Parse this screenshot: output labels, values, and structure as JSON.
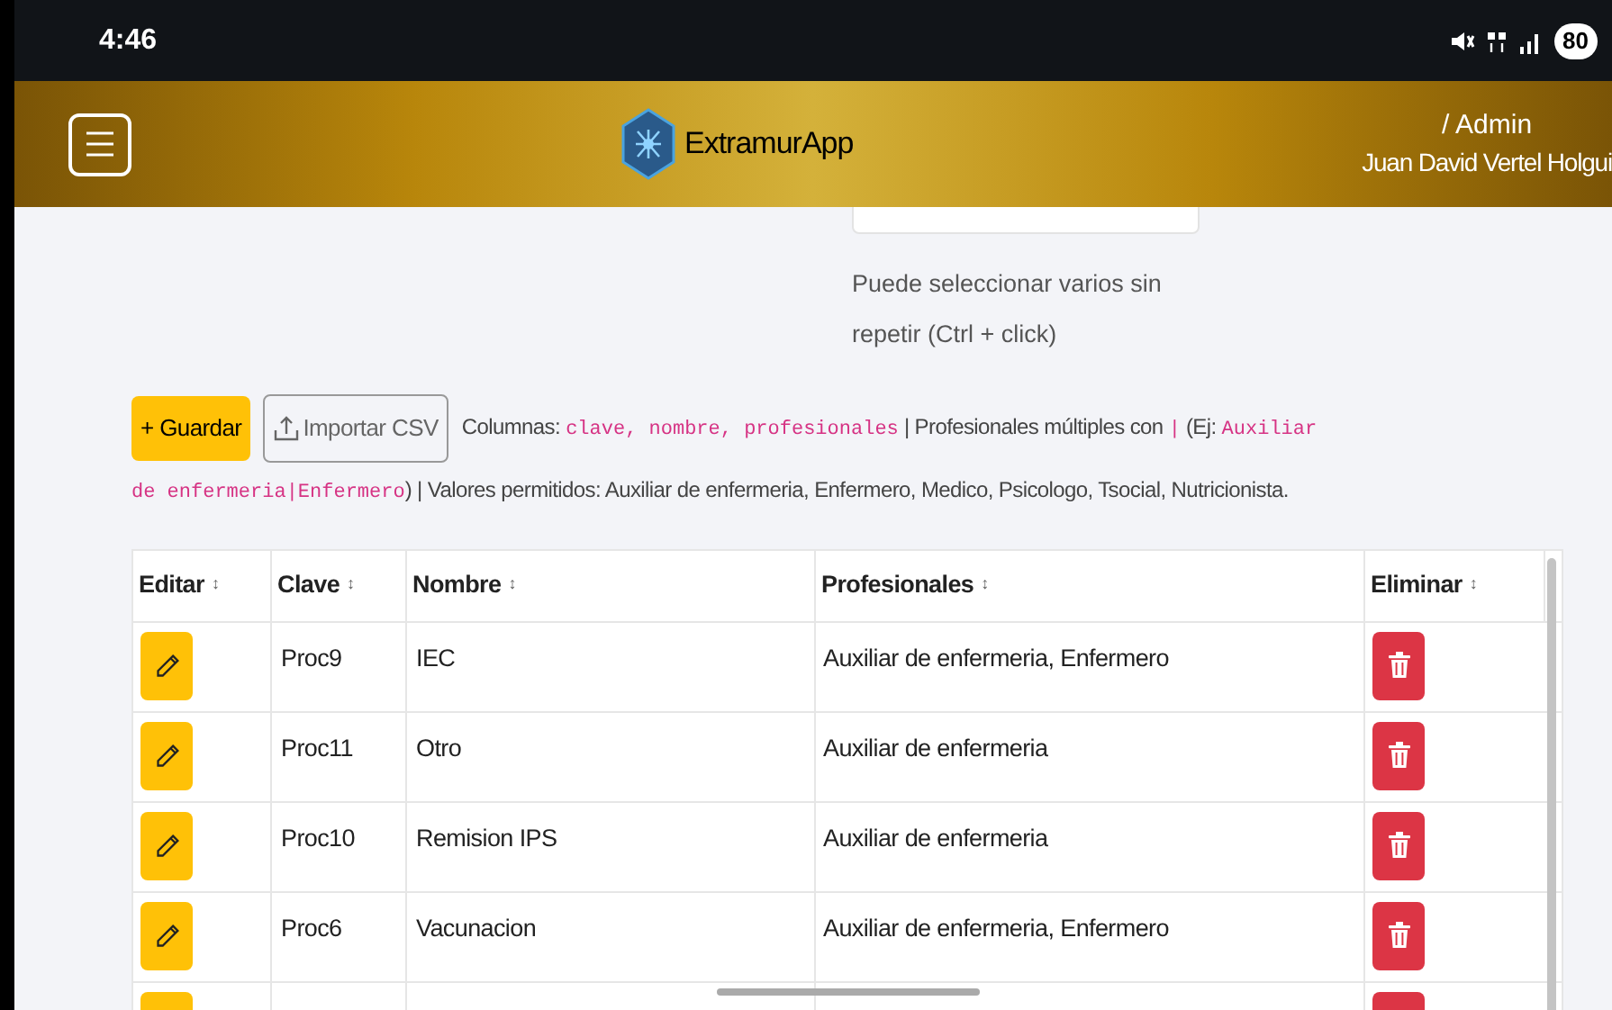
{
  "status_bar": {
    "time": "4:46",
    "battery": "80"
  },
  "header": {
    "app_name": "ExtramurApp",
    "role": "/ Admin",
    "user": "Juan David Vertel Holgui"
  },
  "select_hint": [
    "Puede seleccionar varios sin",
    "repetir (Ctrl + click)"
  ],
  "toolbar": {
    "save": "+ Guardar",
    "import": "Importar CSV"
  },
  "help": [
    [
      {
        "kind": "text",
        "text": "Columnas: "
      },
      {
        "kind": "code",
        "text": "clave, nombre, profesionales"
      },
      {
        "kind": "text",
        "text": " | Profesionales múltiples con "
      },
      {
        "kind": "code",
        "text": "|"
      },
      {
        "kind": "text",
        "text": " (Ej: "
      },
      {
        "kind": "code",
        "text": "Auxiliar"
      }
    ],
    [
      {
        "kind": "code",
        "text": "de enfermeria|Enfermero"
      },
      {
        "kind": "text",
        "text": ") | Valores permitidos: Auxiliar de enfermeria, Enfermero, Medico, Psicologo, Tsocial, Nutricionista."
      }
    ]
  ],
  "table": {
    "columns": [
      "Editar",
      "Clave",
      "Nombre",
      "Profesionales",
      "Eliminar"
    ],
    "sort_mark": "↕",
    "rows": [
      {
        "clave": "Proc9",
        "nombre": "IEC",
        "profesionales": "Auxiliar de enfermeria, Enfermero"
      },
      {
        "clave": "Proc11",
        "nombre": "Otro",
        "profesionales": "Auxiliar de enfermeria"
      },
      {
        "clave": "Proc10",
        "nombre": "Remision IPS",
        "profesionales": "Auxiliar de enfermeria"
      },
      {
        "clave": "Proc6",
        "nombre": "Vacunacion",
        "profesionales": "Auxiliar de enfermeria, Enfermero"
      }
    ]
  }
}
